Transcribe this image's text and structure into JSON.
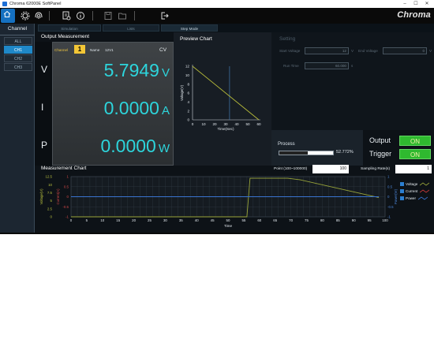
{
  "window": {
    "title": "Chroma 62000E SoftPanel",
    "min": "–",
    "max": "☐",
    "close": "✕"
  },
  "brand": "Chroma",
  "toolbar": {
    "icons": [
      "home-icon",
      "settings-icon",
      "fingerprint-icon",
      "report-icon",
      "info-icon",
      "save-icon",
      "open-folder-icon",
      "exit-icon"
    ]
  },
  "sidebar": {
    "title": "Channel",
    "items": [
      {
        "label": "ALL",
        "active": false
      },
      {
        "label": "CH1",
        "active": true
      },
      {
        "label": "CH2",
        "active": false
      },
      {
        "label": "CH3",
        "active": false
      }
    ]
  },
  "tabs": [
    {
      "label": "Simulation",
      "active": false
    },
    {
      "label": "Lists",
      "active": false
    },
    {
      "label": "Step Mode",
      "active": true
    }
  ],
  "output_measurement": {
    "title": "Output Measurement",
    "channel_label": "Channel",
    "channel_number": "1",
    "name_label": "Name",
    "name_value": "12V1",
    "mode": "CV",
    "rows": [
      {
        "letter": "V",
        "value": "5.7949",
        "unit": "V"
      },
      {
        "letter": "I",
        "value": "0.0000",
        "unit": "A"
      },
      {
        "letter": "P",
        "value": "0.0000",
        "unit": "W"
      }
    ]
  },
  "preview_chart": {
    "title": "Preview Chart",
    "chart_data": {
      "type": "line",
      "title": "Preview Chart",
      "xlabel": "Time(Sec)",
      "ylabel": "Voltage(V)",
      "xlim": [
        0,
        60
      ],
      "ylim": [
        0,
        12
      ],
      "xticks": [
        "0",
        "10",
        "20",
        "30",
        "40",
        "50",
        "60"
      ],
      "yticks": [
        "0",
        "2",
        "4",
        "6",
        "8",
        "10",
        "12"
      ],
      "series": [
        {
          "x": [
            0,
            60
          ],
          "y": [
            12,
            0
          ],
          "color": "#b9bd3a"
        }
      ],
      "marker_x": 33.5
    }
  },
  "setting": {
    "title": "Setting",
    "start_voltage_label": "Start Voltage",
    "start_voltage_value": "12",
    "start_voltage_unit": "V",
    "end_voltage_label": "End Voltage",
    "end_voltage_value": "0",
    "end_voltage_unit": "V",
    "run_time_label": "Run Time",
    "run_time_value": "60.000",
    "run_time_unit": "s"
  },
  "process": {
    "title": "Process",
    "percent": 52.772,
    "percent_text": "52.772%"
  },
  "output": {
    "label": "Output",
    "button": "ON"
  },
  "trigger": {
    "label": "Trigger",
    "button": "ON"
  },
  "measurement_chart": {
    "title": "Measurement Chart",
    "point_label": "Point (100~100000)",
    "point_value": "100",
    "sampling_label": "Sampling Rate(s)",
    "sampling_value": "1",
    "legend": [
      {
        "label": "Voltage",
        "color": "#9aa63a"
      },
      {
        "label": "Current",
        "color": "#cf3a3a"
      },
      {
        "label": "Power",
        "color": "#3a74d0"
      }
    ],
    "chart_data": {
      "type": "line",
      "title": "Measurement Chart",
      "xlabel": "Time",
      "ylabel_left_1": "Voltage(V)",
      "ylabel_left_2": "Current(A)",
      "ylabel_right": "Power(W)",
      "xlim": [
        0,
        100
      ],
      "xticks": [
        "0",
        "5",
        "10",
        "15",
        "20",
        "25",
        "30",
        "35",
        "40",
        "45",
        "50",
        "55",
        "60",
        "65",
        "70",
        "75",
        "80",
        "85",
        "90",
        "95",
        "100"
      ],
      "voltage_ylim": [
        0,
        12.5
      ],
      "voltage_ticks": [
        "12.5",
        "10",
        "7.5",
        "5",
        "2.5",
        "0"
      ],
      "current_ylim": [
        -1,
        1
      ],
      "current_ticks": [
        "1",
        "0.5",
        "0",
        "-0.5",
        "-1"
      ],
      "power_ylim": [
        -1,
        1
      ],
      "power_ticks": [
        "1",
        "0.5",
        "0",
        "-0.5",
        "-1"
      ],
      "series": [
        {
          "name": "Voltage",
          "color": "#9aa63a",
          "x": [
            0,
            56,
            57,
            69,
            73,
            98
          ],
          "y": [
            0,
            0,
            12,
            12,
            11.5,
            6
          ]
        },
        {
          "name": "Current",
          "color": "#cf3a3a",
          "x": [
            0,
            98
          ],
          "y": [
            0,
            0
          ]
        },
        {
          "name": "Power",
          "color": "#3a74d0",
          "x": [
            0,
            98
          ],
          "y": [
            0,
            0
          ]
        }
      ]
    }
  }
}
